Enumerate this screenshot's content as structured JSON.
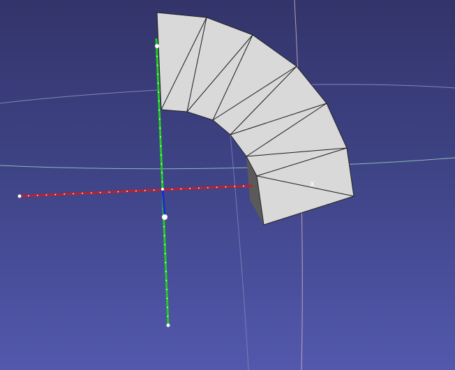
{
  "viewport": {
    "background_top": "#33346a",
    "background_bottom": "#5358ad"
  },
  "axes": {
    "x": {
      "label": "",
      "color": "#c0202a"
    },
    "y": {
      "label": "",
      "color": "#22cc22"
    },
    "z": {
      "label": "",
      "color": "#1a2ad0"
    }
  },
  "mesh": {
    "face_color": "#d9d9d9",
    "side_color": "#5a5a5a",
    "edge_color": "#1a1a1a"
  },
  "marker": {
    "label": "x"
  }
}
